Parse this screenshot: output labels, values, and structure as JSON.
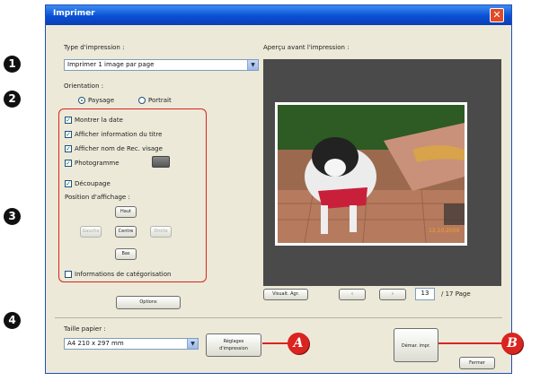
{
  "window": {
    "title": "Imprimer",
    "close_glyph": "✕"
  },
  "print_type": {
    "label": "Type d'impression :",
    "value": "Imprimer 1 image par page",
    "arrow": "▼"
  },
  "orientation": {
    "label": "Orientation :",
    "landscape": "Paysage",
    "portrait": "Portrait",
    "selected": "Paysage"
  },
  "options": {
    "show_date": "Montrer la date",
    "show_title": "Afficher information du titre",
    "show_face": "Afficher nom de Rec. visage",
    "filmstrip": "Photogramme",
    "cropping": "Découpage",
    "display_position": "Position d'affichage :",
    "categorization": "Informations de catégorisation"
  },
  "position_buttons": {
    "up": "Haut",
    "left": "Gauche",
    "center": "Centre",
    "right": "Droite",
    "down": "Bas"
  },
  "options_button": "Options",
  "preview": {
    "label": "Aperçu avant l'impression :",
    "zoom_button": "Visualt. Agr.",
    "prev_glyph": "‹",
    "next_glyph": "›",
    "page_value": "13",
    "page_total": "/ 17 Page"
  },
  "paper": {
    "label": "Taille papier :",
    "value": "A4 210 x 297 mm",
    "settings_line1": "Réglages",
    "settings_line2": "d'impression"
  },
  "start_print": "Démar. impr.",
  "close_button": "Fermer",
  "callouts": {
    "c1": "1",
    "c2": "2",
    "c3": "3",
    "c4": "4",
    "ca": "A",
    "cb": "B"
  },
  "colors": {
    "accent": "#d92420",
    "titlebar": "#0a4fd3",
    "dialog_bg": "#ece9d8",
    "preview_bg": "#4a4a4a"
  }
}
